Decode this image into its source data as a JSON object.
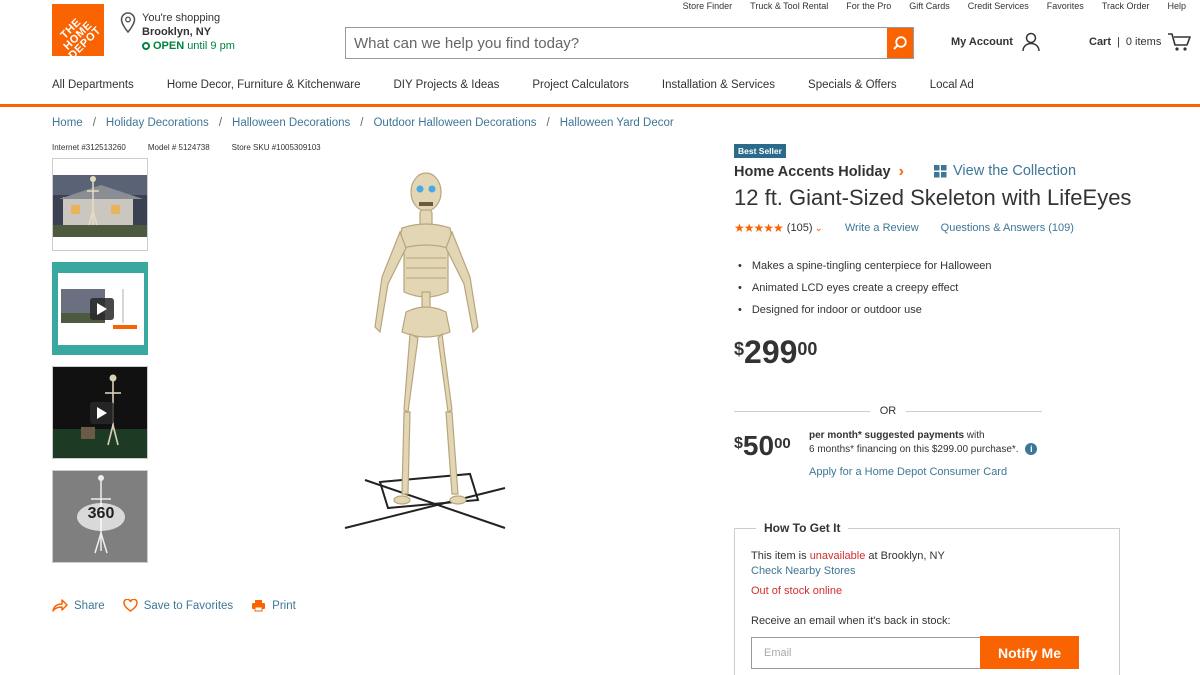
{
  "header": {
    "logo_text": "THE HOME DEPOT",
    "store": {
      "shopping_label": "You're shopping",
      "city": "Brooklyn, NY",
      "open_label": "OPEN",
      "hours": "until 9 pm"
    },
    "util_links": [
      "Store Finder",
      "Truck & Tool Rental",
      "For the Pro",
      "Gift Cards",
      "Credit Services",
      "Favorites",
      "Track Order",
      "Help"
    ],
    "search": {
      "placeholder": "What can we help you find today?"
    },
    "account_label": "My Account",
    "cart": {
      "label": "Cart",
      "separator": "|",
      "count": "0 items"
    }
  },
  "nav": [
    "All Departments",
    "Home Decor, Furniture & Kitchenware",
    "DIY Projects & Ideas",
    "Project Calculators",
    "Installation & Services",
    "Specials & Offers",
    "Local Ad"
  ],
  "breadcrumbs": [
    "Home",
    "Holiday Decorations",
    "Halloween Decorations",
    "Outdoor Halloween Decorations",
    "Halloween Yard Decor"
  ],
  "ids": {
    "internet": "Internet #312513260",
    "model": "Model # 5124738",
    "sku": "Store SKU #1005309103"
  },
  "thumbnails": [
    {
      "name": "skeleton-on-house-thumbnail",
      "video": false
    },
    {
      "name": "product-video-thumbnail",
      "video": true
    },
    {
      "name": "night-video-thumbnail",
      "video": true
    },
    {
      "name": "360-view-thumbnail",
      "label": "360",
      "video": false
    }
  ],
  "actions": {
    "share": "Share",
    "favorites": "Save to Favorites",
    "print": "Print"
  },
  "product": {
    "badge": "Best Seller",
    "brand": "Home Accents Holiday",
    "collection_link": "View the Collection",
    "title": "12 ft. Giant-Sized Skeleton with LifeEyes",
    "rating": {
      "stars": 5,
      "count": "(105)",
      "write_review": "Write a Review",
      "qa": "Questions & Answers (109)"
    },
    "bullets": [
      "Makes a spine-tingling centerpiece for Halloween",
      "Animated LCD eyes create a creepy effect",
      "Designed for indoor or outdoor use"
    ],
    "price": {
      "currency": "$",
      "dollars": "299",
      "cents": "00"
    },
    "or_label": "OR",
    "financing": {
      "currency": "$",
      "dollars": "50",
      "cents": "00",
      "bold_text": "per month* suggested payments",
      "text_1": " with",
      "text_2": "6 months* financing on this $299.00 purchase*.",
      "info_icon": "i",
      "apply_link": "Apply for a Home Depot Consumer Card"
    }
  },
  "fulfillment": {
    "title": "How To Get It",
    "avail_prefix": "This item is ",
    "avail_status": "unavailable",
    "avail_suffix": " at Brooklyn, NY",
    "nearby_link": "Check Nearby Stores",
    "oos": "Out of stock online",
    "receive_label": "Receive an email when it's back in stock:",
    "email_placeholder": "Email",
    "notify_button": "Notify Me"
  },
  "colors": {
    "brand_orange": "#f96302",
    "link_blue": "#3e7697",
    "alert_red": "#d12e2e",
    "open_green": "#00833e"
  },
  "icons": [
    "location-pin-icon",
    "search-icon",
    "user-icon",
    "cart-icon",
    "chevron-right-icon",
    "collection-grid-icon",
    "star-icon",
    "chevron-down-icon",
    "share-icon",
    "heart-icon",
    "print-icon",
    "play-icon",
    "info-icon"
  ]
}
